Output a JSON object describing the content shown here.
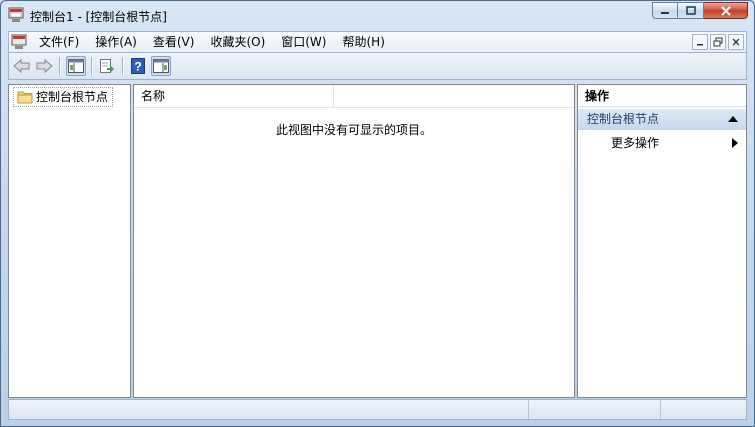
{
  "window": {
    "title": "控制台1 - [控制台根节点]"
  },
  "menu": {
    "items": [
      {
        "label": "文件(F)"
      },
      {
        "label": "操作(A)"
      },
      {
        "label": "查看(V)"
      },
      {
        "label": "收藏夹(O)"
      },
      {
        "label": "窗口(W)"
      },
      {
        "label": "帮助(H)"
      }
    ]
  },
  "tree": {
    "root_label": "控制台根节点"
  },
  "list": {
    "columns": [
      {
        "label": "名称"
      }
    ],
    "empty_message": "此视图中没有可显示的项目。"
  },
  "actions": {
    "title": "操作",
    "group_label": "控制台根节点",
    "more_label": "更多操作"
  },
  "icons": {
    "app": "mmc-console-icon",
    "back": "back-arrow-icon",
    "forward": "forward-arrow-icon",
    "show_hide_tree": "show-hide-console-tree-icon",
    "export": "export-list-icon",
    "help": "help-icon",
    "show_hide_action": "show-hide-action-pane-icon",
    "folder": "folder-icon"
  },
  "colors": {
    "frame": "#c3d6ec",
    "close_button": "#c23a22",
    "action_group": "#c6d8ee"
  }
}
